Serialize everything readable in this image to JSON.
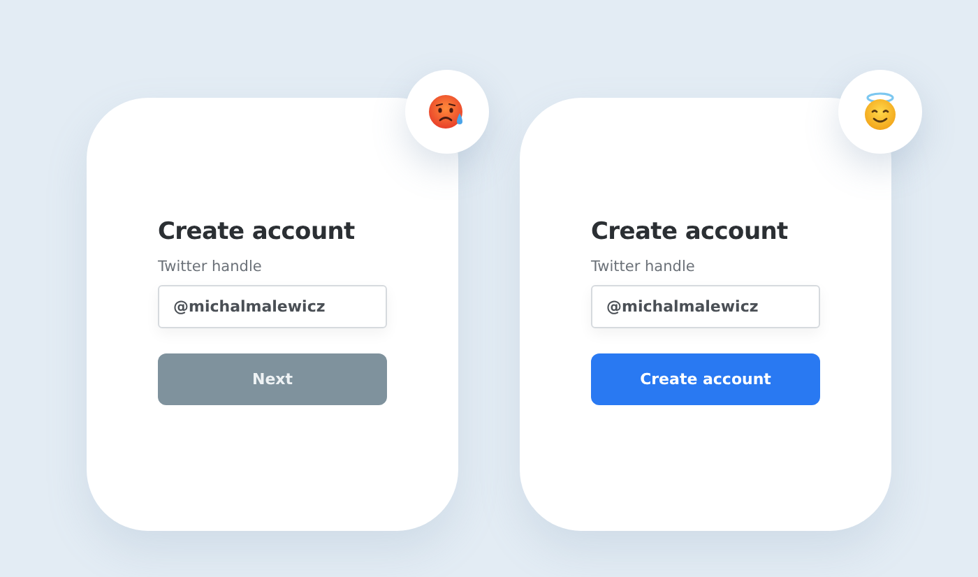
{
  "cards": [
    {
      "badge": {
        "kind": "sad"
      },
      "title": "Create account",
      "field_label": "Twitter handle",
      "field": {
        "value": "@michalmalewicz"
      },
      "button": {
        "label": "Next",
        "disabled": true
      }
    },
    {
      "badge": {
        "kind": "angel"
      },
      "title": "Create account",
      "field_label": "Twitter handle",
      "field": {
        "value": "@michalmalewicz"
      },
      "button": {
        "label": "Create account",
        "disabled": false
      }
    }
  ]
}
